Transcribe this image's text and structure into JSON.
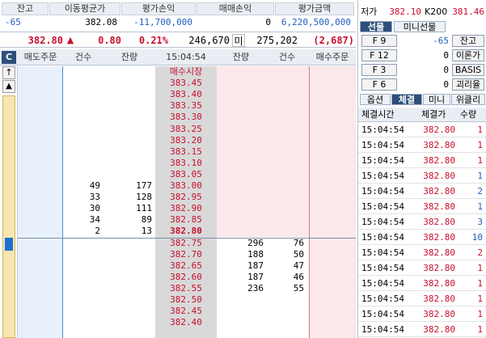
{
  "summary": {
    "headers": [
      "잔고",
      "이동평균가",
      "평가손익",
      "매매손익",
      "평가금액"
    ],
    "values": [
      "-65",
      "382.08",
      "-11,700,000",
      "0",
      "6,220,500,000"
    ]
  },
  "status": {
    "price": "382.80",
    "arrow": "▲",
    "change": "0.80",
    "rate": "0.21%",
    "volume": "246,670",
    "mi_label": "미",
    "open_interest": "275,202",
    "oi_change": "(2,687)"
  },
  "orderbook": {
    "corner_label": "C",
    "headers": [
      "매도주문",
      "건수",
      "잔량",
      "15:04:54",
      "잔량",
      "건수",
      "매수주문"
    ],
    "up_glyph": "↑",
    "triangle_glyph": "▲",
    "market_label": "매수시장",
    "ask_prices": [
      "383.45",
      "383.40",
      "383.35",
      "383.30",
      "383.25",
      "383.20",
      "383.15",
      "383.10",
      "383.05",
      "383.00",
      "382.95",
      "382.90",
      "382.85"
    ],
    "ask_counts": [
      "",
      "",
      "",
      "",
      "",
      "",
      "",
      "",
      "",
      "49",
      "33",
      "30",
      "34"
    ],
    "ask_qty": [
      "",
      "",
      "",
      "",
      "",
      "",
      "",
      "",
      "",
      "177",
      "128",
      "111",
      "89"
    ],
    "current": {
      "price": "382.80",
      "count": "2",
      "qty": "13"
    },
    "bid_prices": [
      "382.75",
      "382.70",
      "382.65",
      "382.60",
      "382.55",
      "382.50",
      "382.45",
      "382.40"
    ],
    "bid_qty": [
      "296",
      "188",
      "187",
      "187",
      "236",
      "",
      "",
      ""
    ],
    "bid_counts": [
      "76",
      "50",
      "47",
      "46",
      "55",
      "",
      "",
      ""
    ]
  },
  "right": {
    "top_rows": [
      {
        "a": "저가",
        "b": "382.10",
        "c": "K200",
        "d": "381.46"
      }
    ],
    "tabs1": [
      "선물",
      "미니선물"
    ],
    "fkeys": [
      {
        "key": "F 9",
        "val": "-65",
        "btn": "잔고"
      },
      {
        "key": "F 12",
        "val": "0",
        "btn": "이론가"
      },
      {
        "key": "F 3",
        "val": "0",
        "btn": "BASIS"
      },
      {
        "key": "F 6",
        "val": "0",
        "btn": "괴리율"
      }
    ],
    "tabs2": [
      "옵션",
      "체결",
      "미니",
      "위클리"
    ],
    "trade_headers": [
      "체결시간",
      "체결가",
      "수량"
    ],
    "trades": [
      {
        "time": "15:04:54",
        "price": "382.80",
        "qty": "1",
        "color": "#c8102e"
      },
      {
        "time": "15:04:54",
        "price": "382.80",
        "qty": "1",
        "color": "#c8102e"
      },
      {
        "time": "15:04:54",
        "price": "382.80",
        "qty": "1",
        "color": "#c8102e"
      },
      {
        "time": "15:04:54",
        "price": "382.80",
        "qty": "1",
        "color": "#1f5fbf"
      },
      {
        "time": "15:04:54",
        "price": "382.80",
        "qty": "2",
        "color": "#1f5fbf"
      },
      {
        "time": "15:04:54",
        "price": "382.80",
        "qty": "1",
        "color": "#1f5fbf"
      },
      {
        "time": "15:04:54",
        "price": "382.80",
        "qty": "3",
        "color": "#1f5fbf"
      },
      {
        "time": "15:04:54",
        "price": "382.80",
        "qty": "10",
        "color": "#1f5fbf"
      },
      {
        "time": "15:04:54",
        "price": "382.80",
        "qty": "2",
        "color": "#c8102e"
      },
      {
        "time": "15:04:54",
        "price": "382.80",
        "qty": "1",
        "color": "#c8102e"
      },
      {
        "time": "15:04:54",
        "price": "382.80",
        "qty": "1",
        "color": "#c8102e"
      },
      {
        "time": "15:04:54",
        "price": "382.80",
        "qty": "1",
        "color": "#c8102e"
      },
      {
        "time": "15:04:54",
        "price": "382.80",
        "qty": "1",
        "color": "#c8102e"
      },
      {
        "time": "15:04:54",
        "price": "382.80",
        "qty": "1",
        "color": "#c8102e"
      }
    ]
  },
  "colors": {
    "up": "#c8102e",
    "down": "#1f5fbf",
    "ask_bg": "#e8f1fb",
    "bid_bg": "#fbe8ea"
  }
}
